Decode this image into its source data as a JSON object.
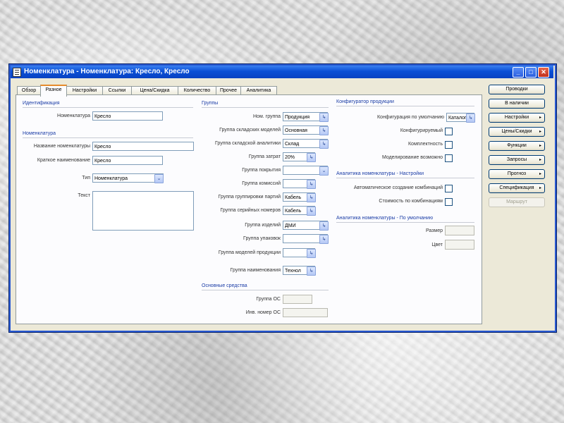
{
  "window": {
    "title": "Номенклатура - Номенклатура: Кресло, Кресло",
    "controls": [
      "_",
      "□",
      "✕"
    ]
  },
  "tabs": [
    {
      "label": "Обзор"
    },
    {
      "label": "Разное"
    },
    {
      "label": "Настройки"
    },
    {
      "label": "Ссылки"
    },
    {
      "label": "Цена/Скидка"
    },
    {
      "label": "Количество"
    },
    {
      "label": "Прочее"
    },
    {
      "label": "Аналитика"
    }
  ],
  "identification": {
    "section": "Идентификация",
    "item_number_label": "Номенклатура",
    "item_number_value": "Кресло"
  },
  "nomenclature": {
    "section": "Номенклатура",
    "name_label": "Название номенклатуры",
    "name_value": "Кресло",
    "short_name_label": "Краткое наименование",
    "short_name_value": "Кресло",
    "type_label": "Тип",
    "type_value": "Номенклатура",
    "text_label": "Текст"
  },
  "groups": {
    "section": "Группы",
    "rows": [
      {
        "label": "Ном. группа",
        "value": "Продукция"
      },
      {
        "label": "Группа складских моделей",
        "value": "Основная"
      },
      {
        "label": "Группа складской аналитики",
        "value": "Склад"
      },
      {
        "label": "Группа затрат",
        "value": "20%"
      },
      {
        "label": "Группа покрытия",
        "value": ""
      },
      {
        "label": "Группа комиссий",
        "value": ""
      },
      {
        "label": "Группа группировки партий",
        "value": "Кабель"
      },
      {
        "label": "Группа серийных номеров",
        "value": "Кабель"
      },
      {
        "label": "Группа изделий",
        "value": "ДМИ"
      },
      {
        "label": "Группа упаковок",
        "value": ""
      },
      {
        "label": "Группа моделей продукции",
        "value": ""
      },
      {
        "label": "Группа наименования",
        "value": "Технол"
      }
    ]
  },
  "fixed_assets": {
    "section": "Основные средства",
    "group_label": "Группа ОС",
    "group_value": "",
    "inv_label": "Инв. номер ОС",
    "inv_value": ""
  },
  "product_config": {
    "section": "Конфигуратор продукции",
    "technology_label": "Конфигурация по умолчанию",
    "technology_value": "Каталог",
    "checks": [
      {
        "label": "Конфигурируемый"
      },
      {
        "label": "Комплектность"
      },
      {
        "label": "Моделирование возможно"
      }
    ]
  },
  "analytics_settings": {
    "section": "Аналитика номенклатуры - Настройки",
    "checks": [
      {
        "label": "Автоматическое создание комбинаций"
      },
      {
        "label": "Стоимость по комбинациям"
      }
    ]
  },
  "analytics_default": {
    "section": "Аналитика номенклатуры - По умолчанию",
    "size_label": "Размер",
    "color_label": "Цвет"
  },
  "buttons": [
    {
      "label": "Проводки",
      "arrow": false,
      "disabled": false
    },
    {
      "label": "В наличии",
      "arrow": false,
      "disabled": false
    },
    {
      "label": "Настройки",
      "arrow": true,
      "disabled": false
    },
    {
      "label": "Цены/Скидки",
      "arrow": true,
      "disabled": false
    },
    {
      "label": "Функции",
      "arrow": true,
      "disabled": false
    },
    {
      "label": "Запросы",
      "arrow": true,
      "disabled": false
    },
    {
      "label": "Прогноз",
      "arrow": true,
      "disabled": false
    },
    {
      "label": "Спецификация",
      "arrow": true,
      "disabled": false
    },
    {
      "label": "Маршрут",
      "arrow": false,
      "disabled": true
    }
  ]
}
